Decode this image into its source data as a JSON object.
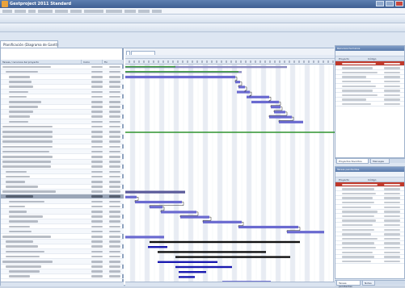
{
  "window": {
    "title": "Gestproject 2011 Standard"
  },
  "document_tab": {
    "label": "Planificación (Diagrama de Gantt)"
  },
  "grid": {
    "columns": [
      "Tareas / recursos del proyecto",
      "Inicio",
      "Fin"
    ],
    "row_count": 43,
    "selected_row": 26,
    "group_rows": [
      0,
      12,
      13,
      14,
      15,
      16,
      17,
      18,
      19,
      20,
      25,
      34,
      39
    ]
  },
  "gantt": {
    "date_field_label": "Ver: 1 Enero 11, 2011",
    "colors": {
      "summary_bar": "#8a8ac0",
      "task_bar": "#6a6ad0",
      "selected_bar": "#5a5a9a",
      "critical_bar": "#111111",
      "milestone_bar": "#1a1ab0",
      "progress": "#3c9a3c",
      "link": "#2a2a2a",
      "nonworking": "#e8ecf3"
    }
  },
  "side_panels": {
    "top": {
      "title": "Recursos humanos",
      "columns": [
        "Proyecto",
        "Código"
      ],
      "row_count": 10,
      "selected_row": 0
    },
    "bottom": {
      "title": "Tareas pendientes",
      "columns": [
        "Proyecto",
        "Código"
      ],
      "row_count": 18,
      "selected_row": 0
    },
    "top_tabs": [
      "Proyectos favoritos",
      "Mensajes"
    ],
    "bottom_tabs": [
      "Tareas pendientes",
      "Notas"
    ]
  }
}
